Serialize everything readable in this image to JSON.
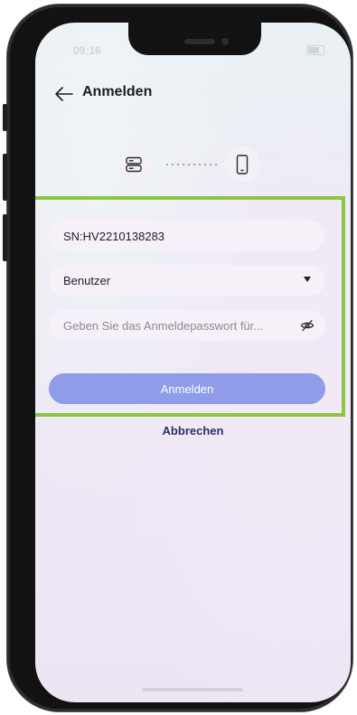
{
  "status_bar": {
    "time": "09:16"
  },
  "header": {
    "title": "Anmelden"
  },
  "device_link": {
    "left_icon": "server-icon",
    "connector": "dotted-connector",
    "right_icon": "smartphone-icon"
  },
  "form": {
    "serial_value": "SN:HV2210138283",
    "user_select": {
      "selected": "Benutzer"
    },
    "password": {
      "placeholder": "Geben Sie das Anmeldepasswort für..."
    },
    "login_label": "Anmelden",
    "cancel_label": "Abbrechen"
  },
  "colors": {
    "highlight_frame": "#8cc53f",
    "login_button": "#8f9ce8",
    "cancel_text": "#2b3160"
  }
}
